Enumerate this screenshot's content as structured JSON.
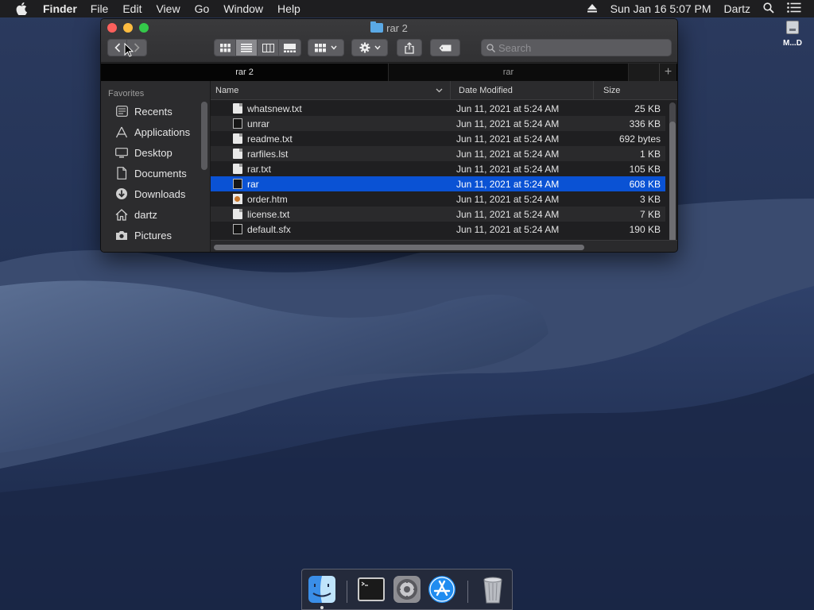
{
  "menubar": {
    "app_name": "Finder",
    "menus": [
      "File",
      "Edit",
      "View",
      "Go",
      "Window",
      "Help"
    ],
    "clock": "Sun Jan 16  5:07 PM",
    "user": "Dartz"
  },
  "desktop": {
    "icon_label": "M...D"
  },
  "window": {
    "title": "rar 2",
    "search_placeholder": "Search",
    "tabs": [
      {
        "label": "rar 2",
        "active": true
      },
      {
        "label": "rar",
        "active": false
      }
    ],
    "add_tab": "+"
  },
  "sidebar": {
    "heading": "Favorites",
    "items": [
      {
        "label": "Recents",
        "icon": "clock-icon"
      },
      {
        "label": "Applications",
        "icon": "applications-icon"
      },
      {
        "label": "Desktop",
        "icon": "desktop-icon"
      },
      {
        "label": "Documents",
        "icon": "documents-icon"
      },
      {
        "label": "Downloads",
        "icon": "downloads-icon"
      },
      {
        "label": "dartz",
        "icon": "home-icon"
      },
      {
        "label": "Pictures",
        "icon": "camera-icon"
      }
    ]
  },
  "columns": {
    "name": "Name",
    "date": "Date Modified",
    "size": "Size"
  },
  "files": [
    {
      "name": "whatsnew.txt",
      "date": "Jun 11, 2021 at 5:24 AM",
      "size": "25 KB",
      "kind": "doc"
    },
    {
      "name": "unrar",
      "date": "Jun 11, 2021 at 5:24 AM",
      "size": "336 KB",
      "kind": "exec"
    },
    {
      "name": "readme.txt",
      "date": "Jun 11, 2021 at 5:24 AM",
      "size": "692 bytes",
      "kind": "doc"
    },
    {
      "name": "rarfiles.lst",
      "date": "Jun 11, 2021 at 5:24 AM",
      "size": "1 KB",
      "kind": "doc"
    },
    {
      "name": "rar.txt",
      "date": "Jun 11, 2021 at 5:24 AM",
      "size": "105 KB",
      "kind": "doc"
    },
    {
      "name": "rar",
      "date": "Jun 11, 2021 at 5:24 AM",
      "size": "608 KB",
      "kind": "exec",
      "selected": true
    },
    {
      "name": "order.htm",
      "date": "Jun 11, 2021 at 5:24 AM",
      "size": "3 KB",
      "kind": "html"
    },
    {
      "name": "license.txt",
      "date": "Jun 11, 2021 at 5:24 AM",
      "size": "7 KB",
      "kind": "doc"
    },
    {
      "name": "default.sfx",
      "date": "Jun 11, 2021 at 5:24 AM",
      "size": "190 KB",
      "kind": "exec"
    }
  ],
  "dock": {
    "items": [
      "finder-icon",
      "terminal-icon",
      "system-preferences-icon",
      "app-store-icon",
      "trash-icon"
    ]
  },
  "colors": {
    "selection": "#0a52d4",
    "close": "#fc605c",
    "minimize": "#fdbc40",
    "maximize": "#34c84a",
    "folder": "#5aa9e6"
  }
}
